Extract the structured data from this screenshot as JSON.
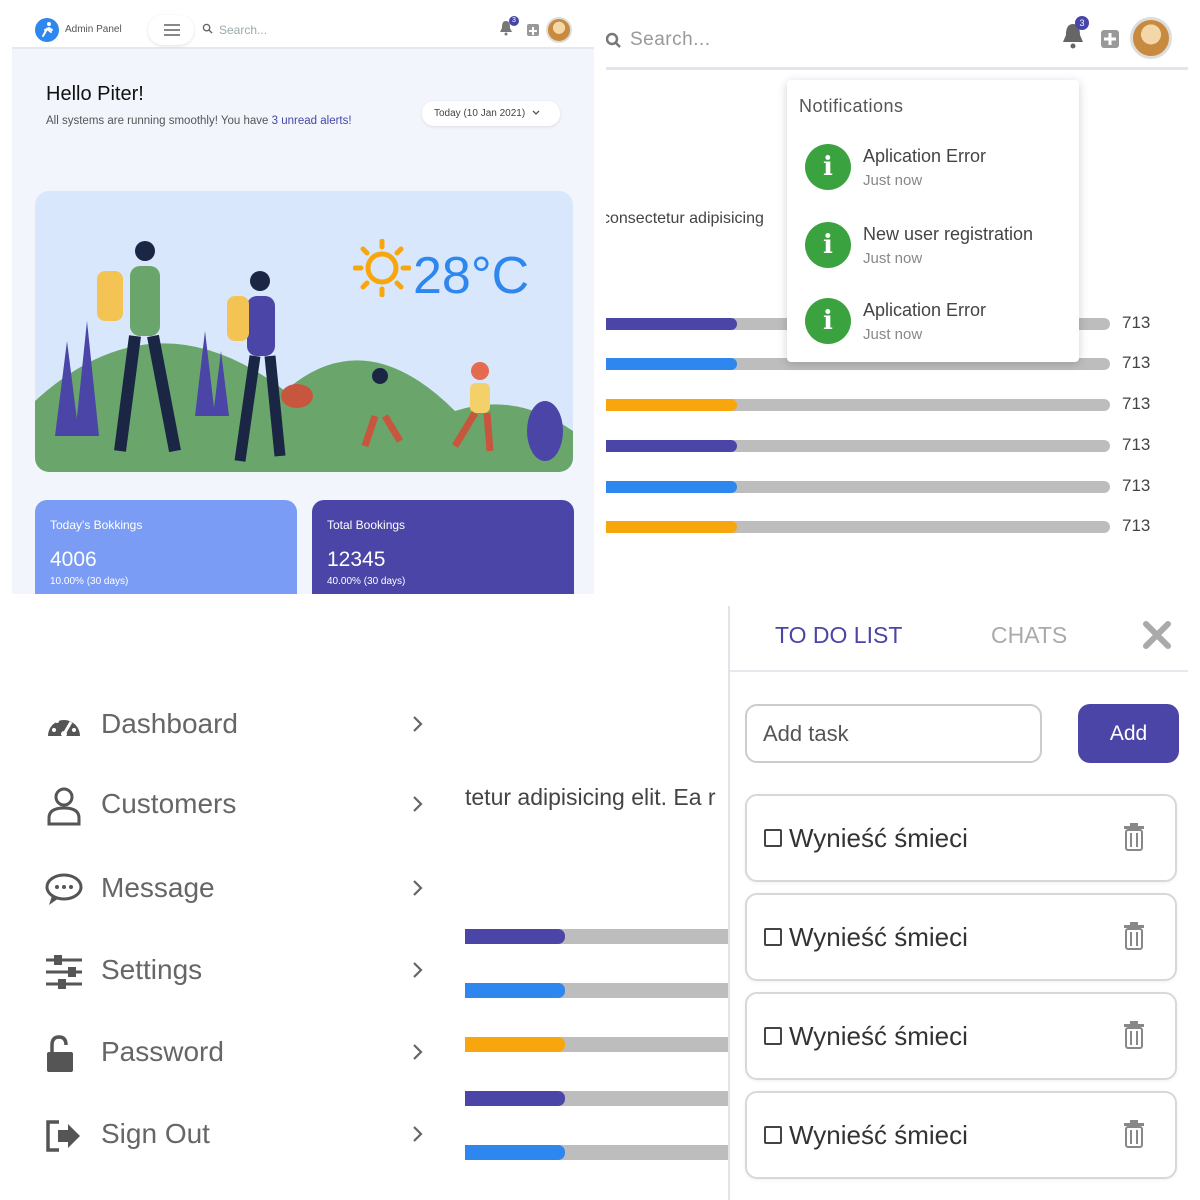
{
  "dashboard": {
    "brand": "Admin Panel",
    "search_placeholder": "Search...",
    "notification_count": "3",
    "greeting": "Hello Piter!",
    "subline_prefix": "All systems are running smoothly! You have ",
    "subline_highlight": "3 unread alerts!",
    "date_button": "Today (10 Jan 2021)",
    "temperature": "28°C",
    "cards": [
      {
        "label": "Today's Bokkings",
        "value": "4006",
        "sub": "10.00% (30 days)"
      },
      {
        "label": "Total Bookings",
        "value": "12345",
        "sub": "40.00% (30 days)"
      }
    ],
    "colors": {
      "primary": "#4a45a6",
      "accent": "#2e86ef",
      "card_light": "#7b9cf5"
    }
  },
  "notifications_panel": {
    "search_placeholder": "Search...",
    "notification_count": "3",
    "title": "Notifications",
    "items": [
      {
        "title": "Aplication Error",
        "time": "Just now"
      },
      {
        "title": "New user registration",
        "time": "Just now"
      },
      {
        "title": "Aplication Error",
        "time": "Just now"
      }
    ],
    "snippet": "consectetur adipisicing",
    "bars": [
      {
        "value": "713",
        "fill": 0.26,
        "color": "#4a45a6"
      },
      {
        "value": "713",
        "fill": 0.26,
        "color": "#2e86ef"
      },
      {
        "value": "713",
        "fill": 0.26,
        "color": "#f7a60d"
      },
      {
        "value": "713",
        "fill": 0.26,
        "color": "#4a45a6"
      },
      {
        "value": "713",
        "fill": 0.26,
        "color": "#2e86ef"
      },
      {
        "value": "713",
        "fill": 0.26,
        "color": "#f7a60d"
      }
    ]
  },
  "sidebar": {
    "items": [
      {
        "label": "Dashboard",
        "icon": "gauge-icon"
      },
      {
        "label": "Customers",
        "icon": "user-icon"
      },
      {
        "label": "Message",
        "icon": "chat-bubble-icon"
      },
      {
        "label": "Settings",
        "icon": "sliders-icon"
      },
      {
        "label": "Password",
        "icon": "unlock-icon"
      },
      {
        "label": "Sign Out",
        "icon": "sign-out-icon"
      }
    ],
    "snippet": "tetur adipisicing elit. Ea r",
    "bars": [
      {
        "fill": 0.38,
        "color": "#4a45a6"
      },
      {
        "fill": 0.38,
        "color": "#2e86ef"
      },
      {
        "fill": 0.38,
        "color": "#f7a60d"
      },
      {
        "fill": 0.38,
        "color": "#4a45a6"
      },
      {
        "fill": 0.38,
        "color": "#2e86ef"
      }
    ]
  },
  "todo": {
    "tab_todo": "TO DO LIST",
    "tab_chats": "CHATS",
    "input_placeholder": "Add task",
    "add_label": "Add",
    "tasks": [
      {
        "text": "Wynieść śmieci"
      },
      {
        "text": "Wynieść śmieci"
      },
      {
        "text": "Wynieść śmieci"
      },
      {
        "text": "Wynieść śmieci"
      }
    ]
  }
}
